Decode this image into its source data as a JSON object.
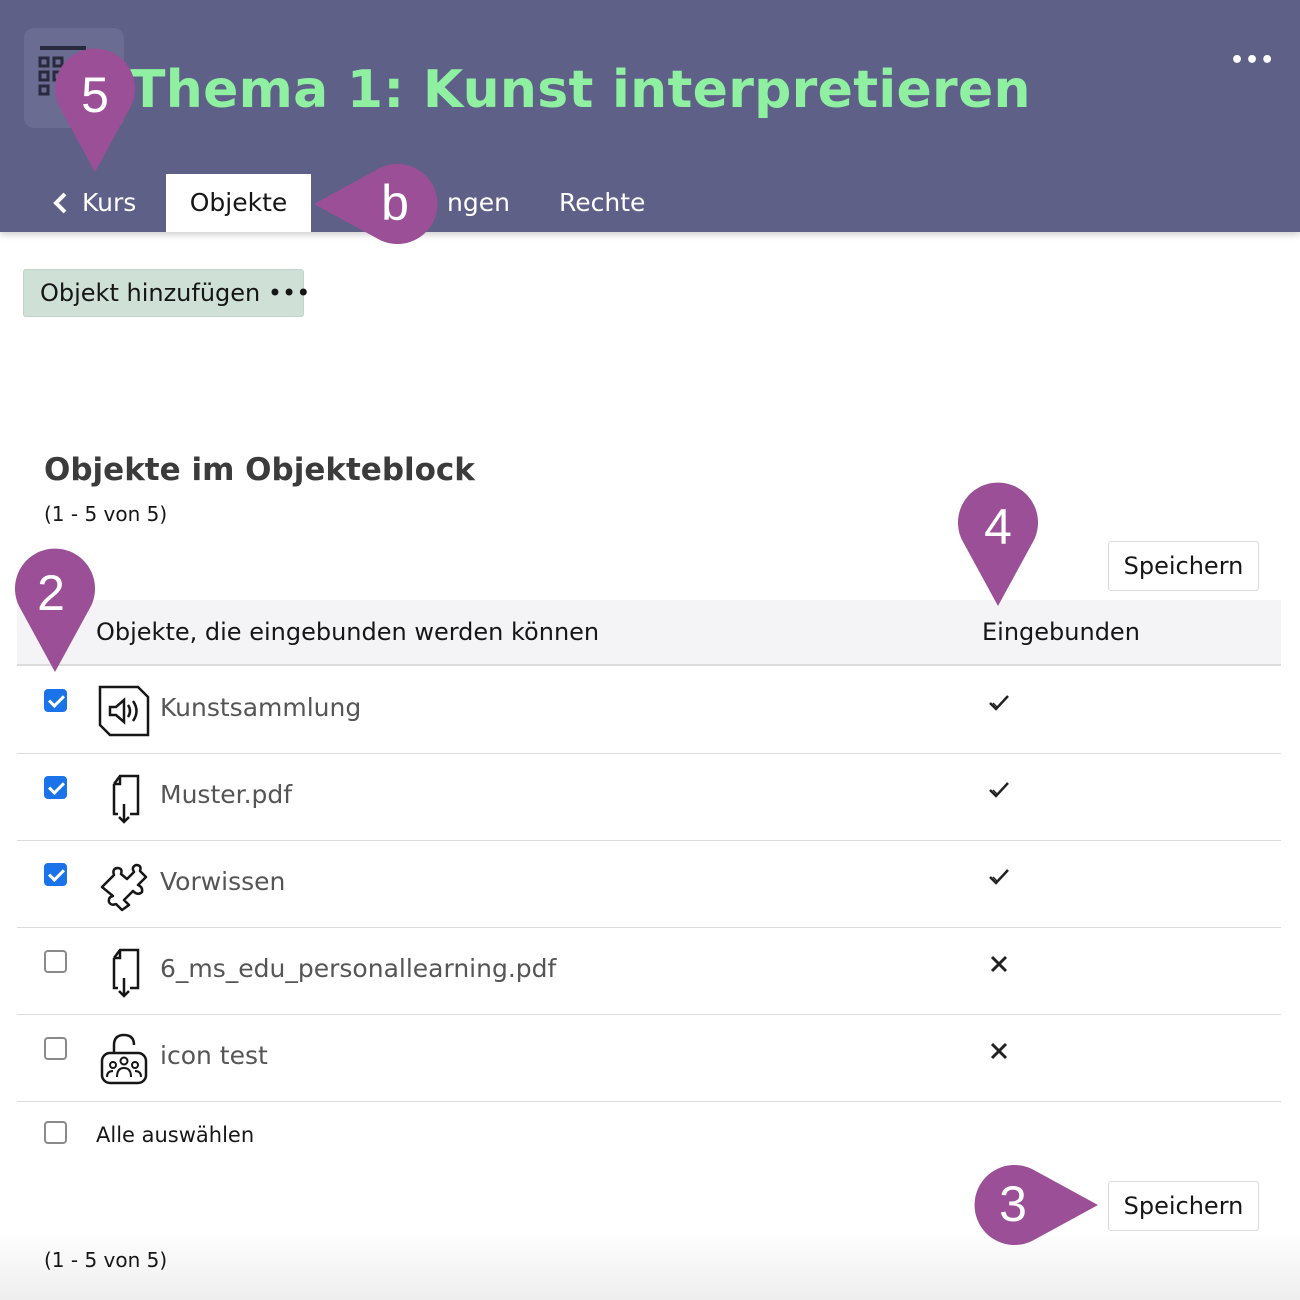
{
  "header": {
    "title": "Thema 1: Kunst interpretieren",
    "more_label": "•••",
    "tabs": [
      {
        "label": "Kurs"
      },
      {
        "label": "Objekte"
      },
      {
        "label": "ngen"
      },
      {
        "label": "Rechte"
      }
    ]
  },
  "toolbar": {
    "add_label": "Objekt hinzufügen •••"
  },
  "block": {
    "title": "Objekte im Objekteblock",
    "range": "(1 - 5 von 5)",
    "save_label": "Speichern"
  },
  "table": {
    "headers": [
      "Objekte, die eingebunden werden können",
      "Eingebunden"
    ],
    "rows": [
      {
        "name": "Kunstsammlung",
        "icon": "audio-file-icon",
        "checked": true,
        "embedded": "check-icon"
      },
      {
        "name": "Muster.pdf",
        "icon": "file-download-icon",
        "checked": true,
        "embedded": "check-icon"
      },
      {
        "name": "Vorwissen",
        "icon": "puzzle-icon",
        "checked": true,
        "embedded": "check-icon"
      },
      {
        "name": "6_ms_edu_personallearning.pdf",
        "icon": "file-download-icon",
        "checked": false,
        "embedded": "cross-icon"
      },
      {
        "name": "icon test",
        "icon": "group-lock-icon",
        "checked": false,
        "embedded": "cross-icon"
      }
    ],
    "select_all_label": "Alle auswählen"
  },
  "annotations": {
    "m5": "5",
    "mb": "b",
    "m4": "4",
    "m2": "2",
    "m3": "3"
  },
  "colors": {
    "header_bg": "#5f6088",
    "title": "#8ef0a0",
    "add_button_bg": "#cfe0d7",
    "marker": "#9b4f96",
    "checkbox_checked": "#1a73e8"
  }
}
